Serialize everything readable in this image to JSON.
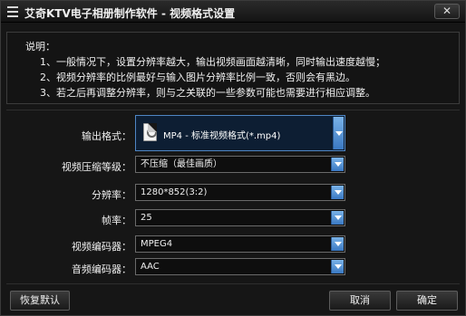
{
  "window": {
    "title": "艾奇KTV电子相册制作软件 - 视频格式设置",
    "close_label": "✕"
  },
  "notes": {
    "heading": "说明：",
    "lines": [
      "1、一般情况下，设置分辨率越大，输出视频画面越清晰，同时输出速度越慢；",
      "2、视频分辨率的比例最好与输入图片分辨率比例一致，否则会有黑边。",
      "3、若之后再调整分辨率，则与之关联的一些参数可能也需要进行相应调整。"
    ]
  },
  "form": {
    "output_format": {
      "label": "输出格式：",
      "value": "MP4 - 标准视频格式(*.mp4)"
    },
    "compression": {
      "label": "视频压缩等级：",
      "value": "不压缩（最佳画质）"
    },
    "resolution": {
      "label": "分辨率：",
      "value": "1280*852(3:2)"
    },
    "frame_rate": {
      "label": "帧率：",
      "value": "25"
    },
    "video_codec": {
      "label": "视频编码器：",
      "value": "MPEG4"
    },
    "audio_codec": {
      "label": "音频编码器：",
      "value": "AAC"
    }
  },
  "buttons": {
    "restore_default": "恢复默认",
    "cancel": "取消",
    "confirm": "确定"
  },
  "colors": {
    "accent": "#3a78c2",
    "background": "#161616"
  }
}
